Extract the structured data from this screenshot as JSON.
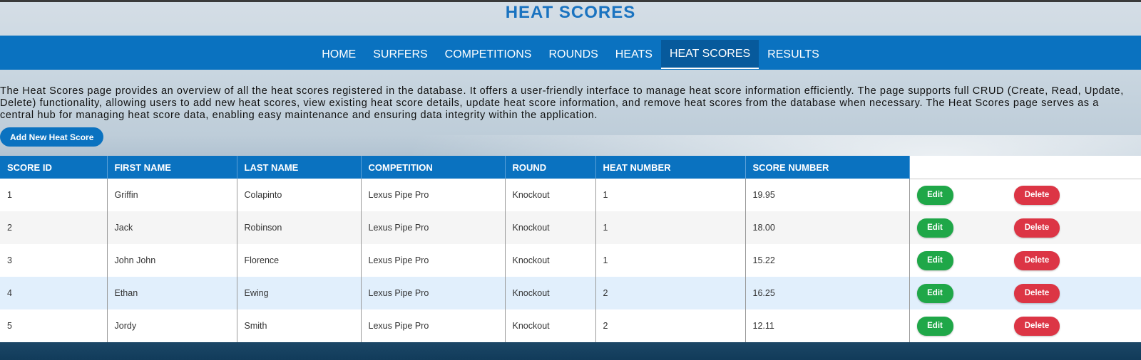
{
  "header": {
    "title": "HEAT SCORES"
  },
  "nav": {
    "items": [
      {
        "label": "HOME"
      },
      {
        "label": "SURFERS"
      },
      {
        "label": "COMPETITIONS"
      },
      {
        "label": "ROUNDS"
      },
      {
        "label": "HEATS"
      },
      {
        "label": "HEAT SCORES",
        "active": true
      },
      {
        "label": "RESULTS"
      }
    ]
  },
  "intro": "The Heat Scores page provides an overview of all the heat scores registered in the database. It offers a user-friendly interface to manage heat score information efficiently. The page supports full CRUD (Create, Read, Update, Delete) functionality, allowing users to add new heat scores, view existing heat score details, update heat score information, and remove heat scores from the database when necessary. The Heat Scores page serves as a central hub for managing heat score data, enabling easy maintenance and ensuring data integrity within the application.",
  "add_button": "Add New Heat Score",
  "table": {
    "columns": [
      "SCORE ID",
      "FIRST NAME",
      "LAST NAME",
      "COMPETITION",
      "ROUND",
      "HEAT NUMBER",
      "SCORE NUMBER"
    ],
    "edit_label": "Edit",
    "delete_label": "Delete",
    "rows": [
      [
        "1",
        "Griffin",
        "Colapinto",
        "Lexus Pipe Pro",
        "Knockout",
        "1",
        "19.95"
      ],
      [
        "2",
        "Jack",
        "Robinson",
        "Lexus Pipe Pro",
        "Knockout",
        "1",
        "18.00"
      ],
      [
        "3",
        "John John",
        "Florence",
        "Lexus Pipe Pro",
        "Knockout",
        "1",
        "15.22"
      ],
      [
        "4",
        "Ethan",
        "Ewing",
        "Lexus Pipe Pro",
        "Knockout",
        "2",
        "16.25"
      ],
      [
        "5",
        "Jordy",
        "Smith",
        "Lexus Pipe Pro",
        "Knockout",
        "2",
        "12.11"
      ]
    ]
  },
  "colors": {
    "primary": "#0a72c0",
    "edit": "#1fa748",
    "delete": "#dc3545",
    "title": "#1a73c0"
  }
}
